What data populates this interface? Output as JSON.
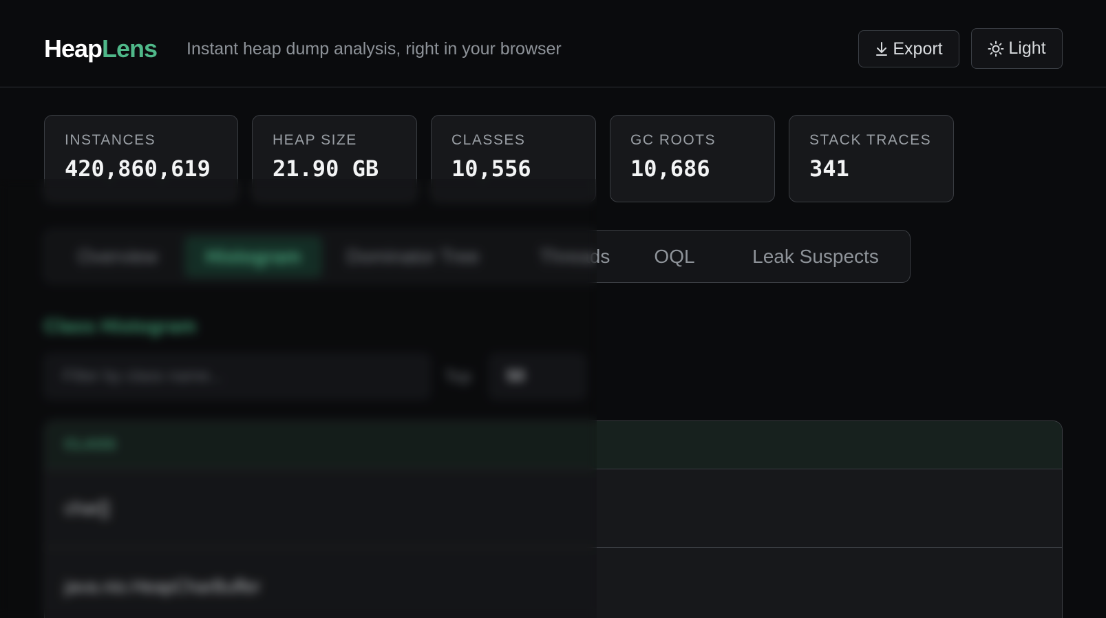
{
  "header": {
    "logo_part1": "Heap",
    "logo_part2": "Lens",
    "tagline": "Instant heap dump analysis, right in your browser",
    "export_label": "Export",
    "theme_label": "Light"
  },
  "stats": [
    {
      "label": "INSTANCES",
      "value": "420,860,619"
    },
    {
      "label": "HEAP SIZE",
      "value": "21.90 GB"
    },
    {
      "label": "CLASSES",
      "value": "10,556"
    },
    {
      "label": "GC ROOTS",
      "value": "10,686"
    },
    {
      "label": "STACK TRACES",
      "value": "341"
    }
  ],
  "tabs": [
    {
      "label": "Overview"
    },
    {
      "label": "Histogram",
      "active": true
    },
    {
      "label": "Dominator Tree"
    },
    {
      "label": "Threads"
    },
    {
      "label": "OQL"
    },
    {
      "label": "Leak Suspects"
    }
  ],
  "histogram": {
    "title": "Class Histogram",
    "filter_placeholder": "Filter by class name...",
    "top_label": "Top",
    "top_value": "50",
    "column_class": "CLASS",
    "rows": [
      {
        "class": "char[]"
      },
      {
        "class": "java.nio.HeapCharBuffer"
      }
    ]
  },
  "colors": {
    "accent": "#4fb889",
    "background": "#0a0b0d",
    "card": "#17181b",
    "border": "#3a3d42"
  }
}
